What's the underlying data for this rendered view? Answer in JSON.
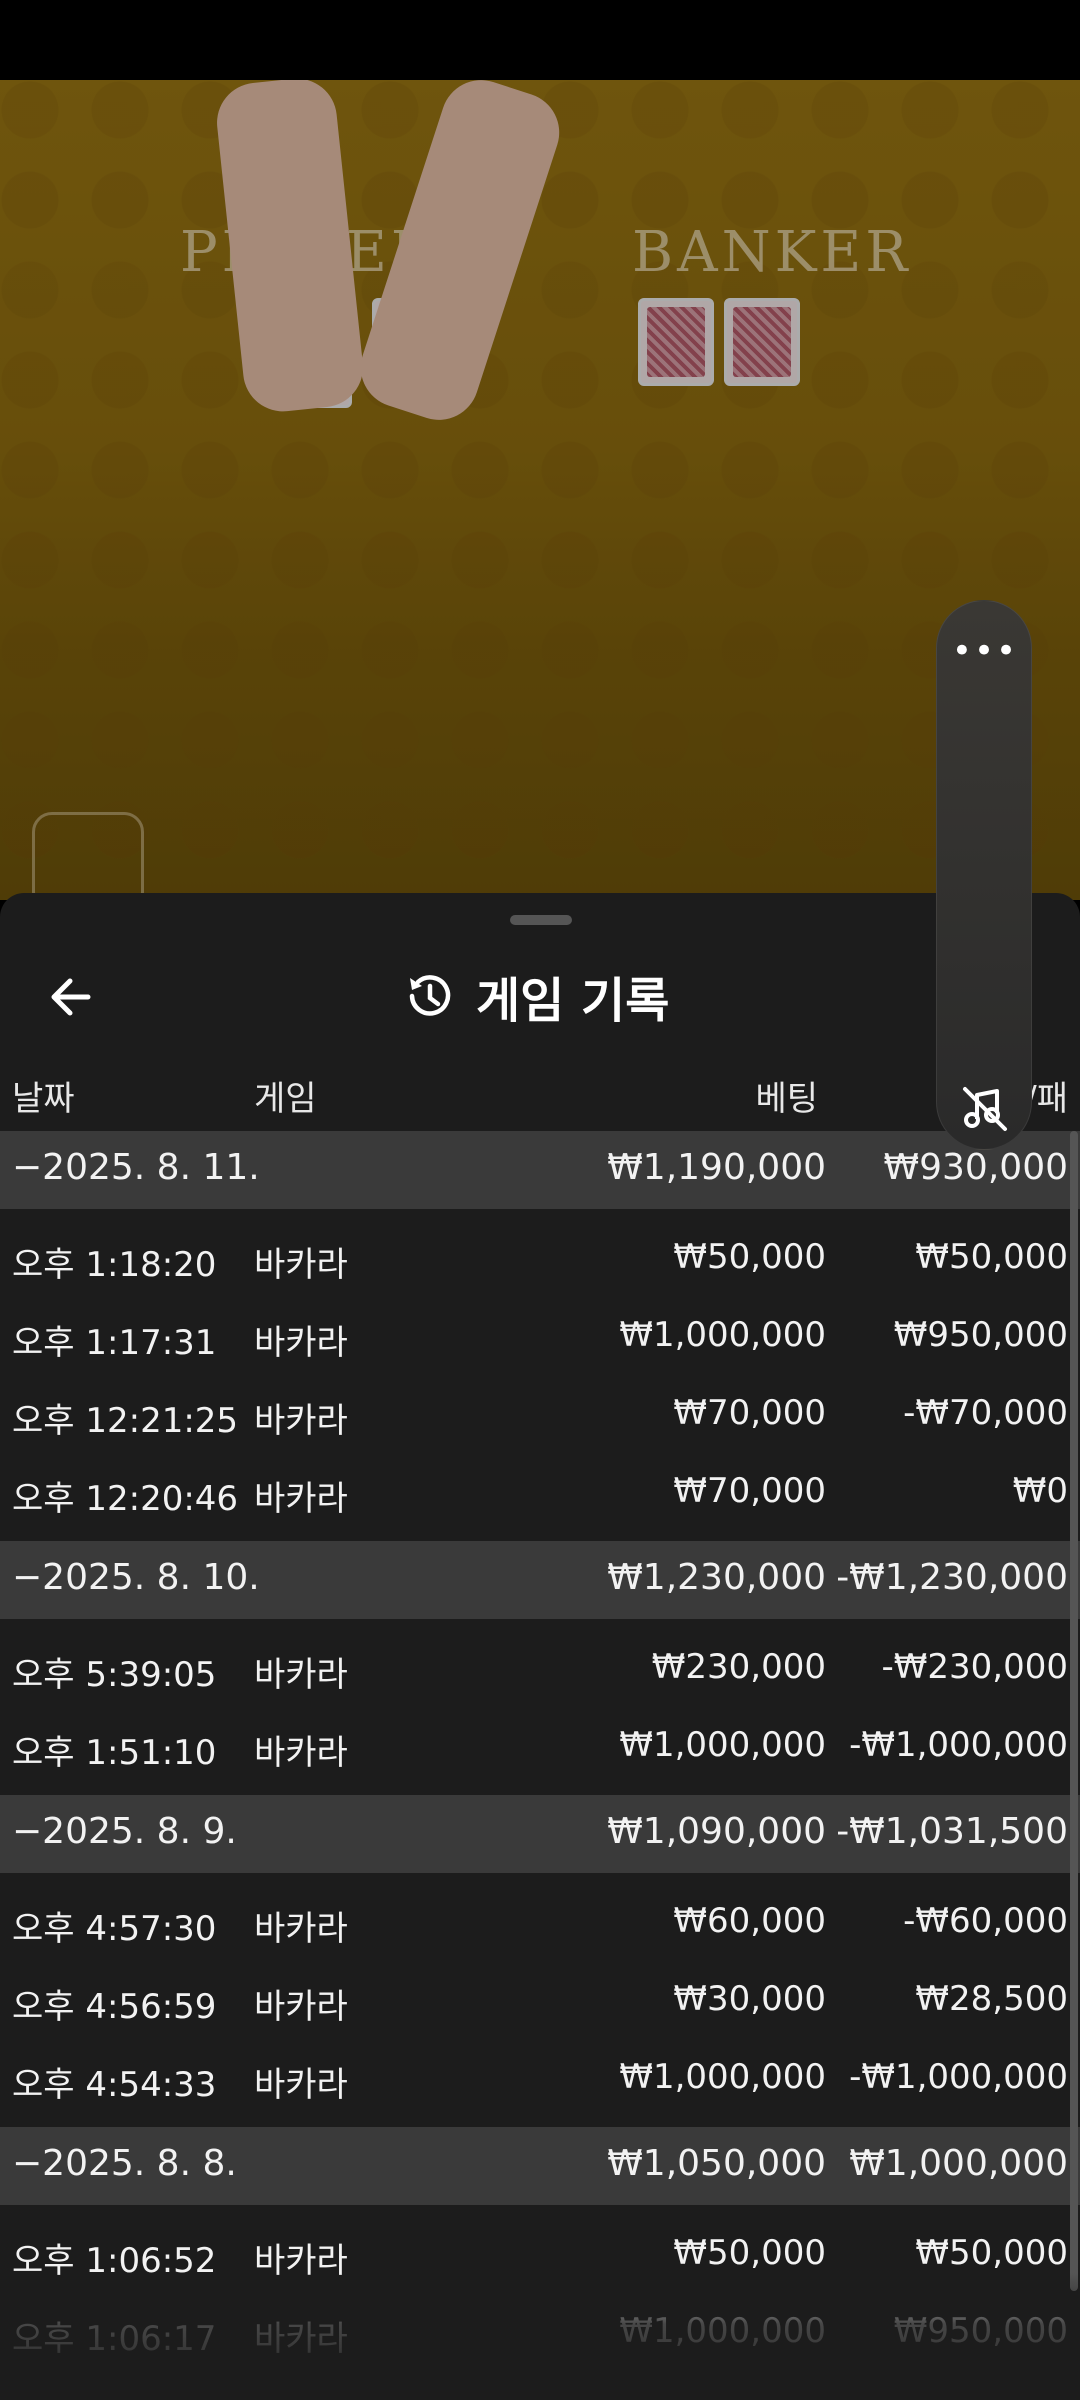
{
  "video": {
    "player_label": "PLAYER",
    "banker_label": "BANKER"
  },
  "panel": {
    "title": "게임 기록",
    "columns": {
      "date": "날짜",
      "game": "게임",
      "bet": "베팅",
      "payout": "승/패"
    }
  },
  "groups": [
    {
      "date": "−2025. 8. 11.",
      "bet": "₩1,190,000",
      "payout": "₩930,000",
      "rows": [
        {
          "time": "오후 1:18:20",
          "game": "바카라",
          "bet": "₩50,000",
          "payout": "₩50,000"
        },
        {
          "time": "오후 1:17:31",
          "game": "바카라",
          "bet": "₩1,000,000",
          "payout": "₩950,000"
        },
        {
          "time": "오후 12:21:25",
          "game": "바카라",
          "bet": "₩70,000",
          "payout": "-₩70,000"
        },
        {
          "time": "오후 12:20:46",
          "game": "바카라",
          "bet": "₩70,000",
          "payout": "₩0"
        }
      ]
    },
    {
      "date": "−2025. 8. 10.",
      "bet": "₩1,230,000",
      "payout": "-₩1,230,000",
      "rows": [
        {
          "time": "오후 5:39:05",
          "game": "바카라",
          "bet": "₩230,000",
          "payout": "-₩230,000"
        },
        {
          "time": "오후 1:51:10",
          "game": "바카라",
          "bet": "₩1,000,000",
          "payout": "-₩1,000,000"
        }
      ]
    },
    {
      "date": "−2025. 8. 9.",
      "bet": "₩1,090,000",
      "payout": "-₩1,031,500",
      "rows": [
        {
          "time": "오후 4:57:30",
          "game": "바카라",
          "bet": "₩60,000",
          "payout": "-₩60,000"
        },
        {
          "time": "오후 4:56:59",
          "game": "바카라",
          "bet": "₩30,000",
          "payout": "₩28,500"
        },
        {
          "time": "오후 4:54:33",
          "game": "바카라",
          "bet": "₩1,000,000",
          "payout": "-₩1,000,000"
        }
      ]
    },
    {
      "date": "−2025. 8. 8.",
      "bet": "₩1,050,000",
      "payout": "₩1,000,000",
      "rows": [
        {
          "time": "오후 1:06:52",
          "game": "바카라",
          "bet": "₩50,000",
          "payout": "₩50,000"
        },
        {
          "time": "오후 1:06:17",
          "game": "바카라",
          "bet": "₩1,000,000",
          "payout": "₩950,000"
        }
      ]
    }
  ]
}
